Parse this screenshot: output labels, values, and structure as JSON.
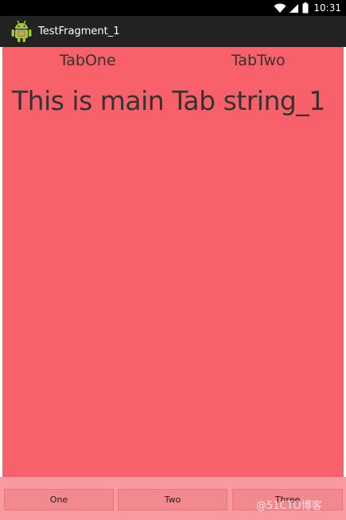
{
  "status_bar": {
    "time": "10:31",
    "icons": [
      "wifi-icon",
      "signal-icon",
      "battery-icon"
    ]
  },
  "action_bar": {
    "app_icon": "android-icon",
    "title": "TestFragment_1"
  },
  "tabs": [
    {
      "label": "TabOne"
    },
    {
      "label": "TabTwo"
    }
  ],
  "main": {
    "tab_string": "This is main Tab string_1"
  },
  "bottom_buttons": [
    {
      "label": "One"
    },
    {
      "label": "Two"
    },
    {
      "label": "Three"
    }
  ],
  "watermark": "@51CTO博客",
  "colors": {
    "content_background": "#f8616a",
    "bottom_bar": "#f99aa0",
    "button": "#f1898e",
    "action_bar": "#222222",
    "status_bar": "#000000",
    "text": "#333333"
  }
}
